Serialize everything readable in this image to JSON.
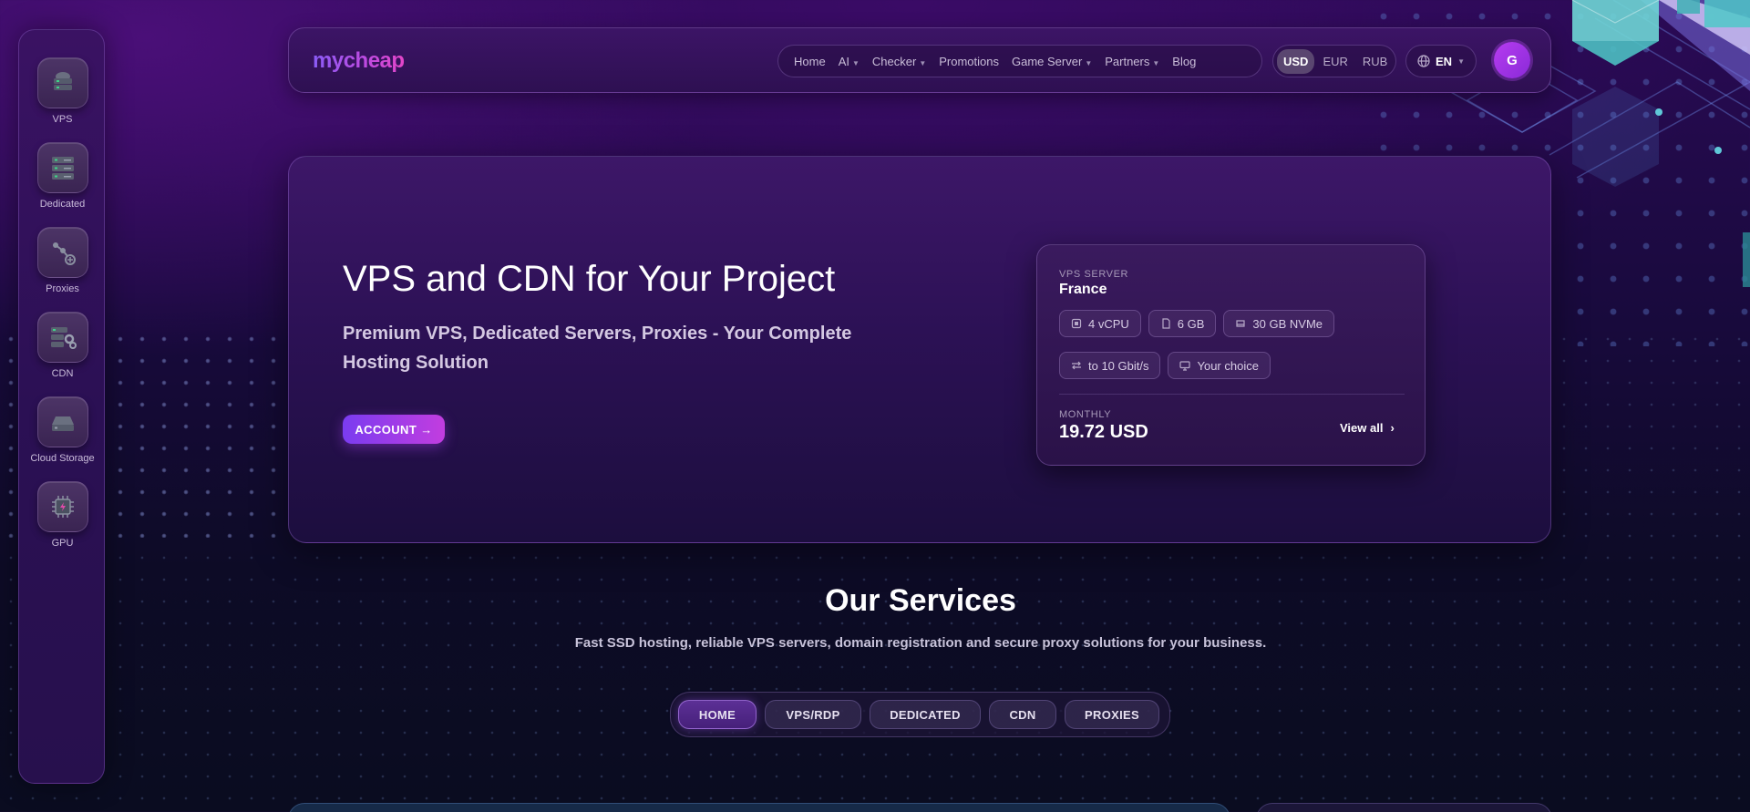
{
  "sidebar": {
    "items": [
      {
        "label": "VPS",
        "icon": "vps-icon"
      },
      {
        "label": "Dedicated",
        "icon": "dedicated-server-icon"
      },
      {
        "label": "Proxies",
        "icon": "proxies-icon"
      },
      {
        "label": "CDN",
        "icon": "cdn-icon"
      },
      {
        "label": "Cloud Storage",
        "icon": "cloud-storage-icon"
      },
      {
        "label": "GPU",
        "icon": "gpu-chip-icon"
      }
    ]
  },
  "header": {
    "logo": "mycheap",
    "nav": [
      {
        "label": "Home",
        "dropdown": false
      },
      {
        "label": "AI",
        "dropdown": true
      },
      {
        "label": "Checker",
        "dropdown": true
      },
      {
        "label": "Promotions",
        "dropdown": false
      },
      {
        "label": "Game Server",
        "dropdown": true
      },
      {
        "label": "Partners",
        "dropdown": true
      },
      {
        "label": "Blog",
        "dropdown": false
      }
    ],
    "currencies": [
      "USD",
      "EUR",
      "RUB"
    ],
    "active_currency": "USD",
    "language": "EN",
    "avatar_letter": "G"
  },
  "hero": {
    "title": "VPS and CDN for Your Project",
    "subtitle": "Premium VPS, Dedicated Servers, Proxies - Your Complete Hosting Solution",
    "account_button": "ACCOUNT →",
    "card": {
      "caption": "VPS SERVER",
      "location": "France",
      "specs": {
        "cpu": "4 vCPU",
        "ram": "6 GB",
        "disk": "30 GB NVMe",
        "network": "to 10 Gbit/s",
        "os": "Your choice"
      },
      "period_label": "MONTHLY",
      "price": "19.72 USD",
      "view_all": "View all"
    }
  },
  "services": {
    "title": "Our Services",
    "subtitle": "Fast SSD hosting, reliable VPS servers, domain registration and secure proxy solutions for your business.",
    "tabs": [
      "HOME",
      "VPS/RDP",
      "DEDICATED",
      "CDN",
      "PROXIES"
    ],
    "active_tab": "HOME"
  },
  "colors": {
    "accent_purple": "#8a5cf6",
    "accent_magenta": "#c23ddf",
    "background_dark": "#0d0b26"
  }
}
